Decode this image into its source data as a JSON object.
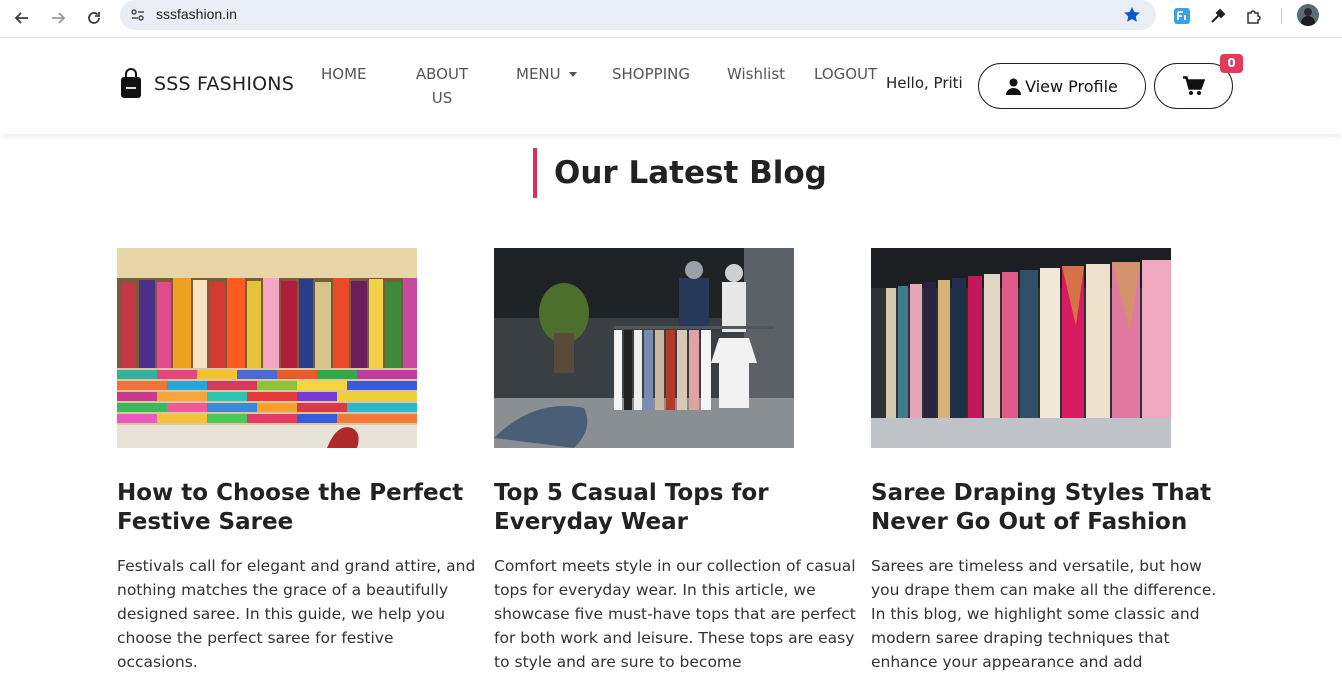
{
  "browser": {
    "url": "sssfashion.in"
  },
  "header": {
    "brand": "SSS FASHIONS",
    "nav": [
      {
        "label": "HOME"
      },
      {
        "label": "ABOUT US"
      },
      {
        "label": "MENU"
      },
      {
        "label": "SHOPPING"
      },
      {
        "label": "Wishlist"
      },
      {
        "label": "LOGOUT"
      }
    ],
    "greeting": "Hello, Priti",
    "profile_label": "View Profile",
    "cart_count": "0"
  },
  "blog": {
    "title": "Our Latest Blog",
    "posts": [
      {
        "title": "How to Choose the Perfect Festive Saree",
        "excerpt": "Festivals call for elegant and grand attire, and nothing matches the grace of a beautifully designed saree. In this guide, we help you choose the perfect saree for festive occasions."
      },
      {
        "title": "Top 5 Casual Tops for Everyday Wear",
        "excerpt": "Comfort meets style in our collection of casual tops for everyday wear. In this article, we showcase five must-have tops that are perfect for both work and leisure. These tops are easy to style and are sure to become"
      },
      {
        "title": "Saree Draping Styles That Never Go Out of Fashion",
        "excerpt": "Sarees are timeless and versatile, but how you drape them can make all the difference. In this blog, we highlight some classic and modern saree draping techniques that enhance your appearance and add"
      }
    ]
  }
}
